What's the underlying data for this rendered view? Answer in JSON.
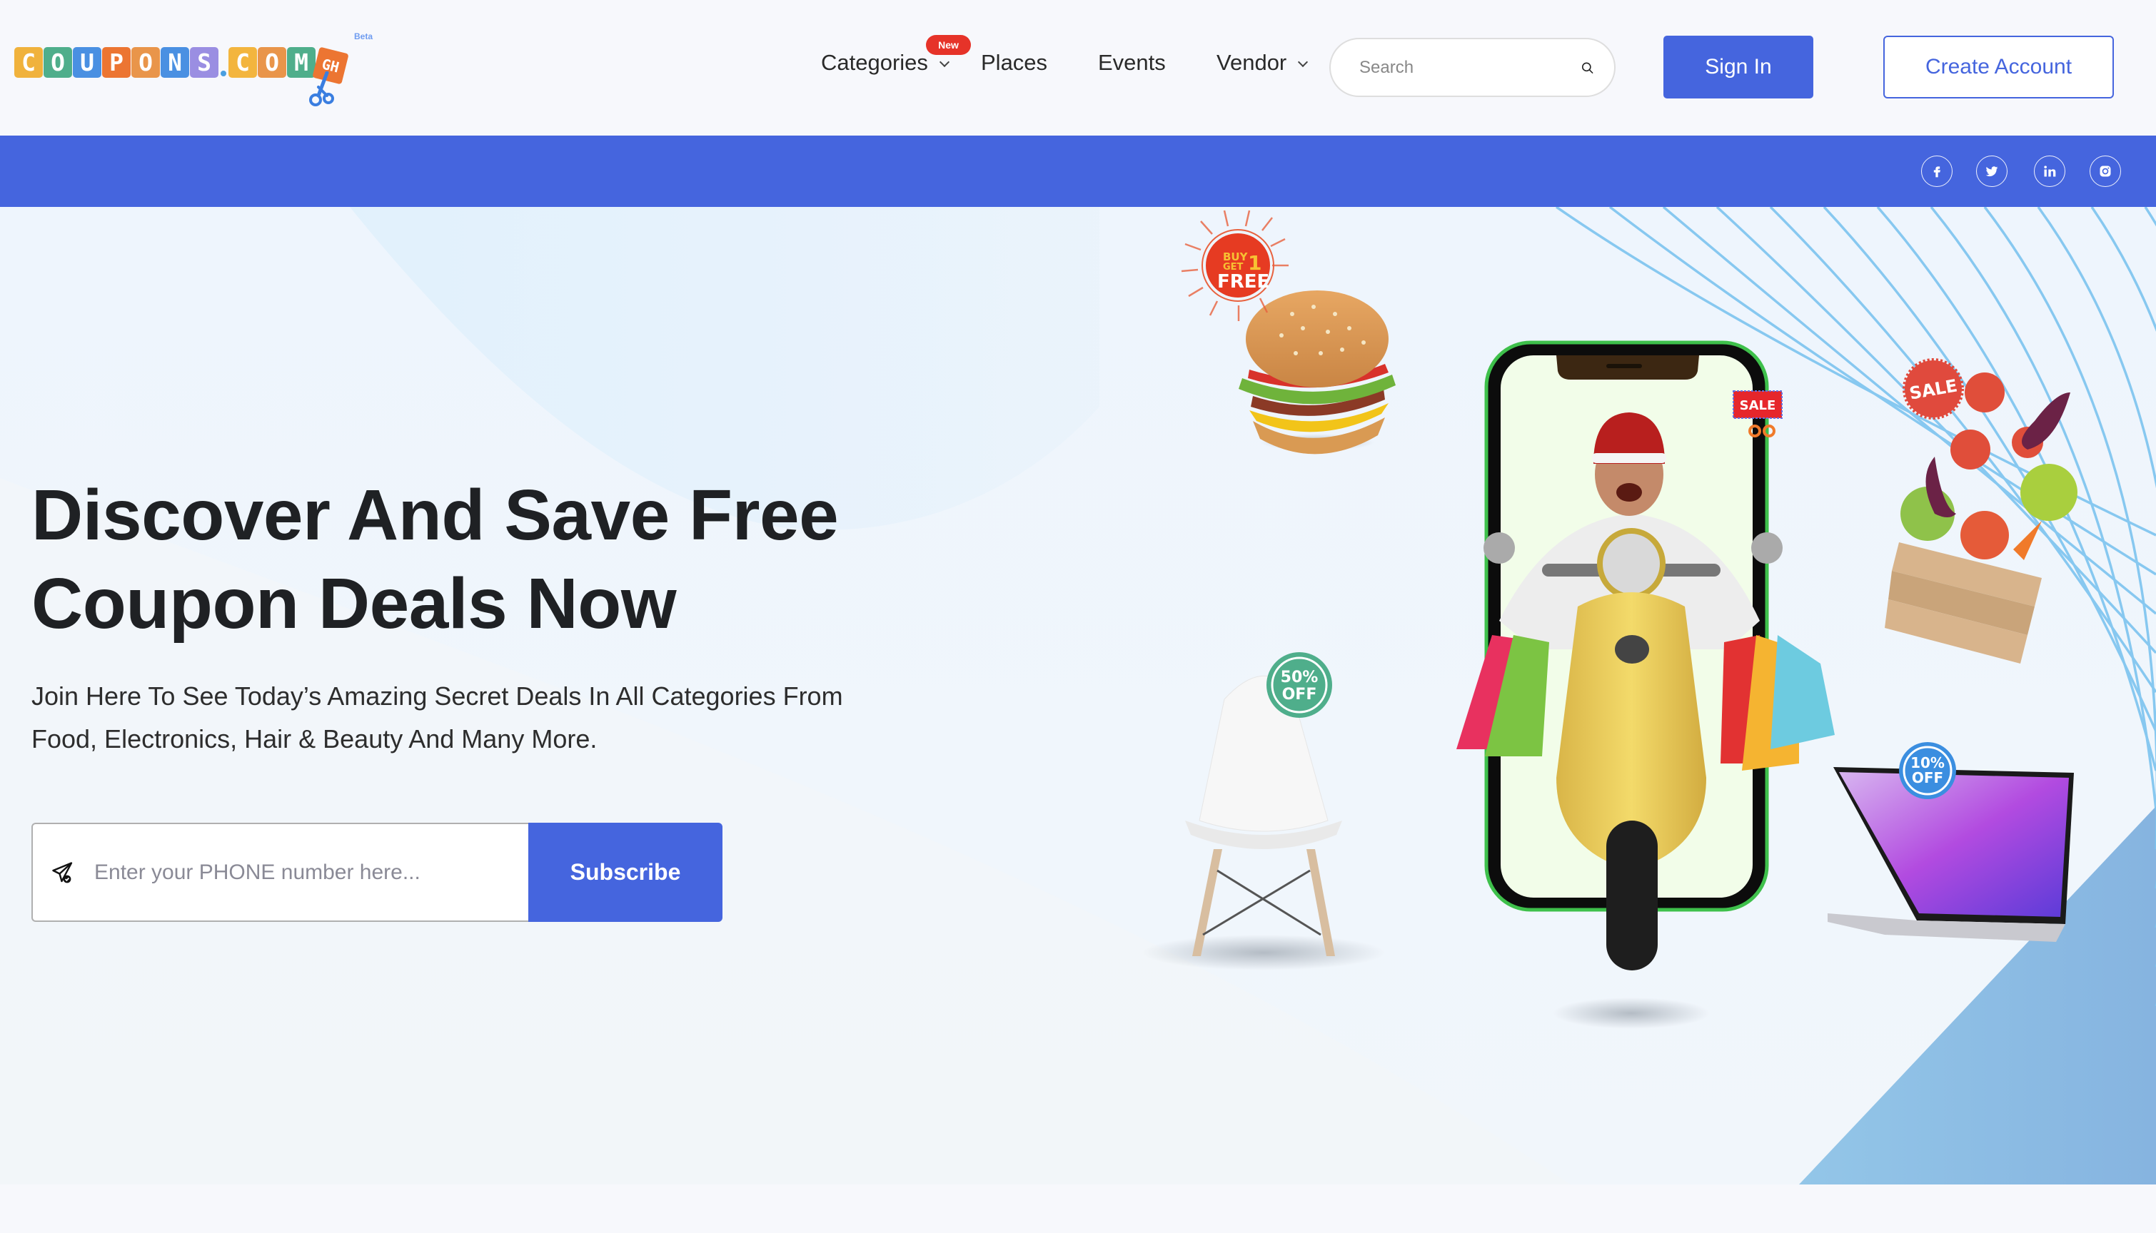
{
  "brand": {
    "logo_letters": [
      "C",
      "O",
      "U",
      "P",
      "O",
      "N",
      "S",
      ".",
      "C",
      "O",
      "M"
    ],
    "logo_suffix": "GH",
    "beta_label": "Beta",
    "tile_colors": [
      "#f0b23c",
      "#4fae8b",
      "#4a90e2",
      "#ec7532",
      "#e9954a",
      "#4a90e2",
      "#9a8ee2",
      "",
      "#f3b53e",
      "#e9954a",
      "#4fae8b"
    ]
  },
  "nav": {
    "items": [
      {
        "label": "Categories",
        "has_dropdown": true,
        "badge": "New"
      },
      {
        "label": "Places",
        "has_dropdown": false
      },
      {
        "label": "Events",
        "has_dropdown": false
      },
      {
        "label": "Vendor",
        "has_dropdown": true
      }
    ],
    "search": {
      "placeholder": "Search",
      "value": "",
      "icon": "search-icon"
    },
    "sign_in_label": "Sign In",
    "create_account_label": "Create Account"
  },
  "social_bar": {
    "icons": [
      "facebook-icon",
      "twitter-icon",
      "linkedin-icon",
      "instagram-icon"
    ]
  },
  "hero": {
    "title_line1": "Discover And Save Free",
    "title_line2": "Coupon Deals Now",
    "lead_line1": "Join Here To See Today’s Amazing Secret Deals In All Categories From",
    "lead_line2": "Food, Electronics, Hair & Beauty And Many More.",
    "subscribe": {
      "placeholder": "Enter your PHONE number here...",
      "value": "",
      "button_label": "Subscribe",
      "icon": "send-icon"
    }
  },
  "illustration": {
    "badges": {
      "burger_line1": "BUY",
      "burger_line2": "GET",
      "burger_num": "1",
      "burger_line3": "FREE",
      "phone_sale": "SALE",
      "veg_sale": "SALE",
      "chair_line1": "50%",
      "chair_line2": "OFF",
      "laptop_line1": "10%",
      "laptop_line2": "OFF"
    }
  },
  "colors": {
    "primary": "#4565de",
    "new_badge": "#e63329",
    "heading": "#1f2124"
  }
}
